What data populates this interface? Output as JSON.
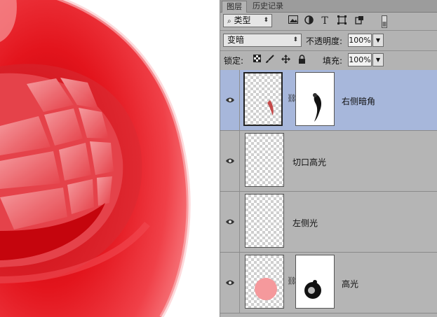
{
  "tabs": [
    "图层",
    "历史记录"
  ],
  "filter": {
    "label": "类型"
  },
  "filter_icons": [
    "image-filter-icon",
    "adjustment-filter-icon",
    "type-filter-icon",
    "shape-filter-icon",
    "smart-object-filter-icon",
    "filter-toggle-icon"
  ],
  "blend": {
    "mode": "变暗",
    "opacity_label": "不透明度:",
    "opacity": "100%"
  },
  "lock": {
    "label": "锁定:",
    "icons": [
      "lock-transparent-icon",
      "lock-brush-icon",
      "lock-move-icon",
      "lock-all-icon"
    ],
    "fill_label": "填充:",
    "fill": "100%"
  },
  "layers": [
    {
      "name": "右侧暗角",
      "selected": true,
      "has_mask": true,
      "visible": true
    },
    {
      "name": "切口高光",
      "selected": false,
      "has_mask": false,
      "visible": true
    },
    {
      "name": "左侧光",
      "selected": false,
      "has_mask": false,
      "visible": true
    },
    {
      "name": "高光",
      "selected": false,
      "has_mask": true,
      "visible": true
    }
  ]
}
